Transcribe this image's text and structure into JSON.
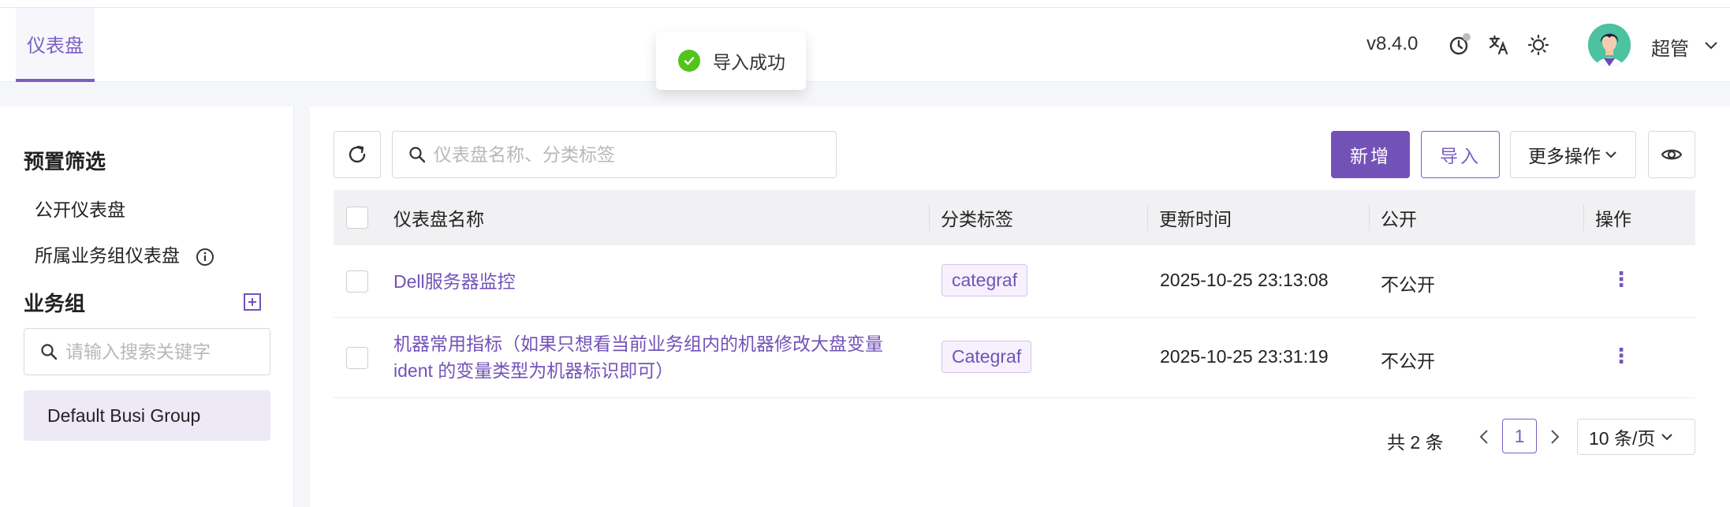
{
  "header": {
    "tab_label": "仪表盘",
    "version": "v8.4.0",
    "username": "超管"
  },
  "toast": {
    "text": "导入成功"
  },
  "sidebar": {
    "preset_title": "预置筛选",
    "preset_items": [
      "公开仪表盘",
      "所属业务组仪表盘"
    ],
    "group_title": "业务组",
    "search_placeholder": "请输入搜索关键字",
    "selected_group": "Default Busi Group"
  },
  "toolbar": {
    "search_placeholder": "仪表盘名称、分类标签",
    "new_label": "新增",
    "import_label": "导入",
    "more_label": "更多操作"
  },
  "table": {
    "columns": [
      "仪表盘名称",
      "分类标签",
      "更新时间",
      "公开",
      "操作"
    ],
    "rows": [
      {
        "name": "Dell服务器监控",
        "tag": "categraf",
        "updated": "2025-10-25 23:13:08",
        "public": "不公开"
      },
      {
        "name_line1": "机器常用指标（如果只想看当前业务组内的机器修改大盘变量",
        "name_line2": "ident 的变量类型为机器标识即可）",
        "tag": "Categraf",
        "updated": "2025-10-25 23:31:19",
        "public": "不公开"
      }
    ]
  },
  "pagination": {
    "total": "共 2 条",
    "current_page": "1",
    "page_size": "10 条/页"
  },
  "colors": {
    "accent": "#7352b8",
    "success": "#52c41a"
  }
}
